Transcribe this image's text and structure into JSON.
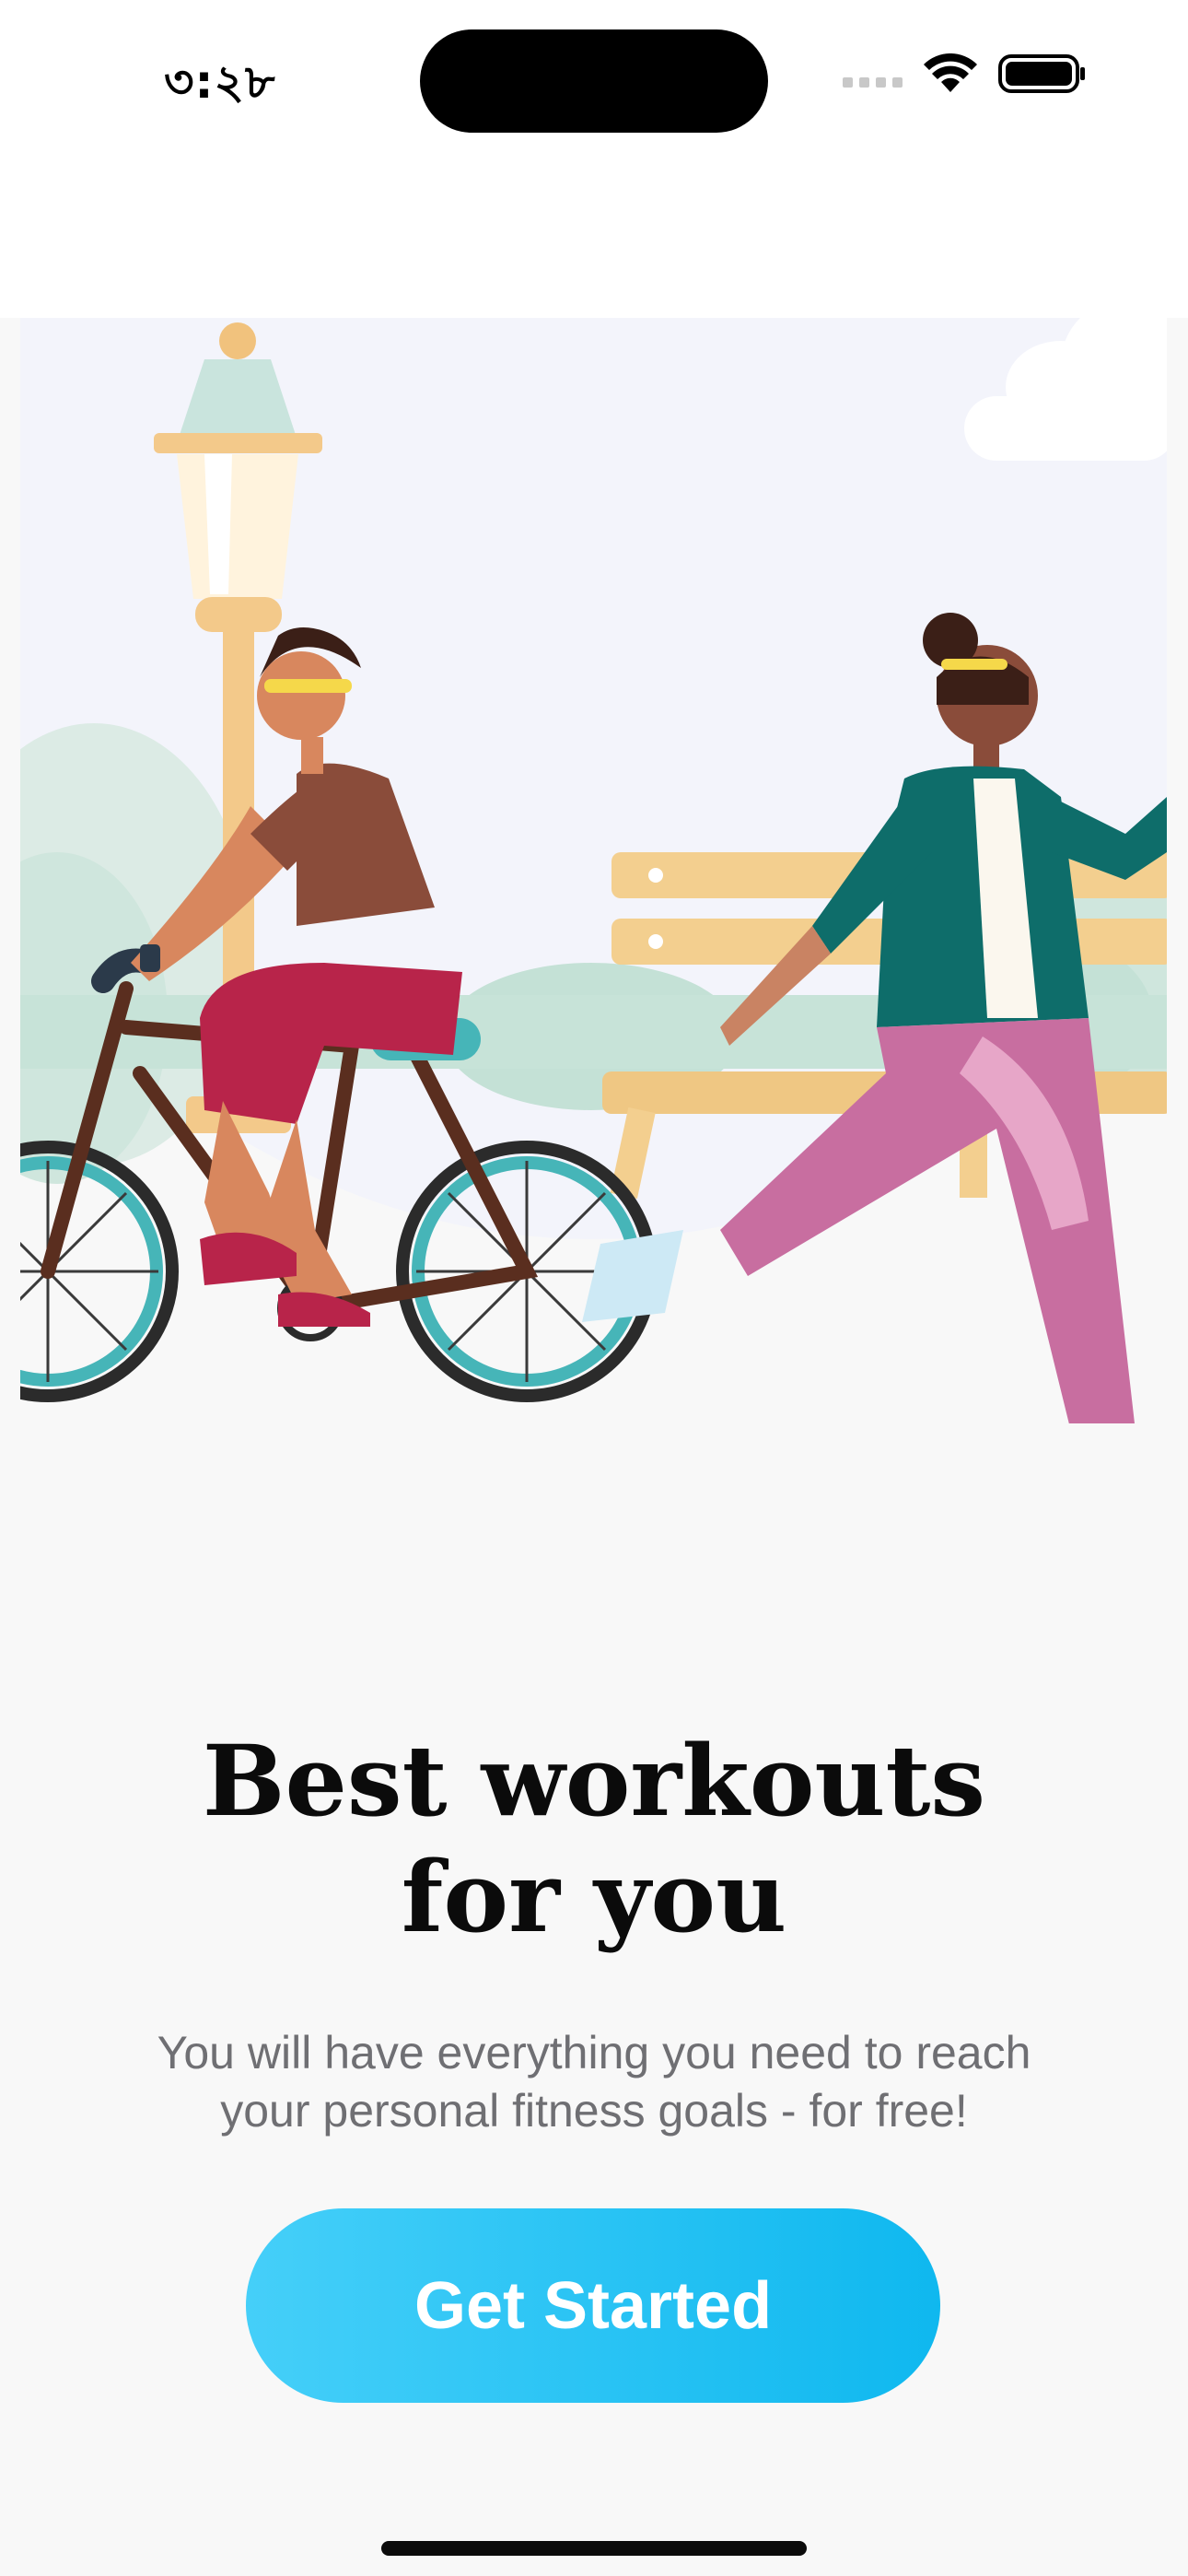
{
  "status_bar": {
    "time": "৩:২৮"
  },
  "onboarding": {
    "illustration": "cyclist-and-runner-in-park",
    "title_line1": "Best workouts",
    "title_line2": "for you",
    "subtitle_line1": "You will have everything you need to reach",
    "subtitle_line2": "your personal fitness goals - for free!",
    "cta_label": "Get Started"
  },
  "colors": {
    "accent_start": "#45cff9",
    "accent_end": "#0fb8ef",
    "background": "#f8f8f8",
    "hero_background": "#f3f4fb"
  }
}
